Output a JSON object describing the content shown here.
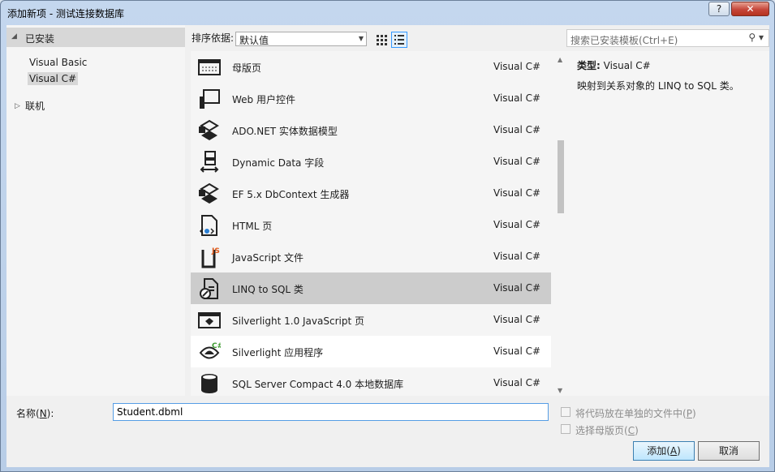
{
  "window": {
    "title": "添加新项 - 测试连接数据库",
    "help": "?",
    "close": "✕"
  },
  "left": {
    "installed": "已安装",
    "items": [
      "Visual Basic",
      "Visual C#"
    ],
    "online": "联机"
  },
  "toolbar": {
    "sort_label": "排序依据:",
    "sort_value": "默认值"
  },
  "search": {
    "placeholder": "搜索已安装模板(Ctrl+E)"
  },
  "templates": [
    {
      "name": "母版页",
      "lang": "Visual C#",
      "icon": "master-page-icon"
    },
    {
      "name": "Web 用户控件",
      "lang": "Visual C#",
      "icon": "web-user-control-icon"
    },
    {
      "name": "ADO.NET 实体数据模型",
      "lang": "Visual C#",
      "icon": "entity-model-icon"
    },
    {
      "name": "Dynamic Data 字段",
      "lang": "Visual C#",
      "icon": "dynamic-data-icon"
    },
    {
      "name": "EF 5.x DbContext 生成器",
      "lang": "Visual C#",
      "icon": "dbcontext-generator-icon"
    },
    {
      "name": "HTML 页",
      "lang": "Visual C#",
      "icon": "html-page-icon"
    },
    {
      "name": "JavaScript 文件",
      "lang": "Visual C#",
      "icon": "javascript-file-icon"
    },
    {
      "name": "LINQ to SQL 类",
      "lang": "Visual C#",
      "icon": "linq-to-sql-icon"
    },
    {
      "name": "Silverlight 1.0 JavaScript 页",
      "lang": "Visual C#",
      "icon": "silverlight-js-page-icon"
    },
    {
      "name": "Silverlight 应用程序",
      "lang": "Visual C#",
      "icon": "silverlight-app-icon"
    },
    {
      "name": "SQL Server Compact 4.0 本地数据库",
      "lang": "Visual C#",
      "icon": "database-icon"
    }
  ],
  "details": {
    "type_label": "类型:",
    "type_value": "Visual C#",
    "description": "映射到关系对象的 LINQ to SQL 类。"
  },
  "bottom": {
    "name_label_pre": "名称(",
    "name_label_key": "N",
    "name_label_post": "):",
    "name_value": "Student.dbml",
    "option1_pre": "将代码放在单独的文件中(",
    "option1_key": "P",
    "option1_post": ")",
    "option2_pre": "选择母版页(",
    "option2_key": "C",
    "option2_post": ")",
    "add_pre": "添加(",
    "add_key": "A",
    "add_post": ")",
    "cancel": "取消"
  }
}
